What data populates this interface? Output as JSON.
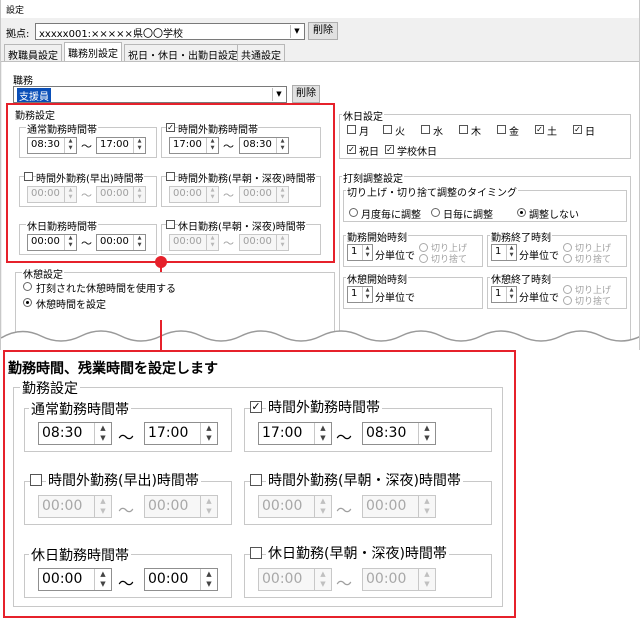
{
  "window": {
    "title": "設定"
  },
  "top": {
    "location_label": "拠点:",
    "location_value": "xxxxx001:×××××県〇〇学校",
    "delete_label": "削除",
    "tabs": [
      "教職員設定",
      "職務別設定",
      "祝日・休日・出勤日設定",
      "共通設定"
    ],
    "job_label": "職務",
    "job_value": "支援員",
    "job_delete_label": "削除"
  },
  "work": {
    "title": "勤務設定",
    "normal": {
      "label": "通常勤務時間帯",
      "from": "08:30",
      "to": "17:00"
    },
    "overtime": {
      "label": "時間外勤務時間帯",
      "checked": true,
      "from": "17:00",
      "to": "08:30"
    },
    "early": {
      "label": "時間外勤務(早出)時間帯",
      "checked": false,
      "from": "00:00",
      "to": "00:00"
    },
    "early_late": {
      "label": "時間外勤務(早朝・深夜)時間帯",
      "checked": false,
      "from": "00:00",
      "to": "00:00"
    },
    "holiday": {
      "label": "休日勤務時間帯",
      "from": "00:00",
      "to": "00:00"
    },
    "holiday_early_late": {
      "label": "休日勤務(早朝・深夜)時間帯",
      "checked": false,
      "from": "00:00",
      "to": "00:00"
    },
    "tilde": "～"
  },
  "holiday_settings": {
    "title": "休日設定",
    "days": [
      {
        "label": "月",
        "checked": false
      },
      {
        "label": "火",
        "checked": false
      },
      {
        "label": "水",
        "checked": false
      },
      {
        "label": "木",
        "checked": false
      },
      {
        "label": "金",
        "checked": false
      },
      {
        "label": "土",
        "checked": true
      },
      {
        "label": "日",
        "checked": true
      }
    ],
    "national_holiday": "祝日",
    "school_holiday": "学校休日"
  },
  "stamp": {
    "title": "打刻調整設定",
    "timing_title": "切り上げ・切り捨て調整のタイミング",
    "timing_options": [
      "月度毎に調整",
      "日毎に調整",
      "調整しない"
    ],
    "work_start": "勤務開始時刻",
    "work_end": "勤務終了時刻",
    "break_start": "休憩開始時刻",
    "break_end": "休憩終了時刻",
    "unit_value": "1",
    "unit_label": "分単位で",
    "round_up": "切り上げ",
    "round_down": "切り捨て"
  },
  "break": {
    "title": "休憩設定",
    "option1": "打刻された休憩時間を使用する",
    "option2": "休憩時間を設定"
  },
  "zoom": {
    "heading": "勤務時間、残業時間を設定します"
  }
}
